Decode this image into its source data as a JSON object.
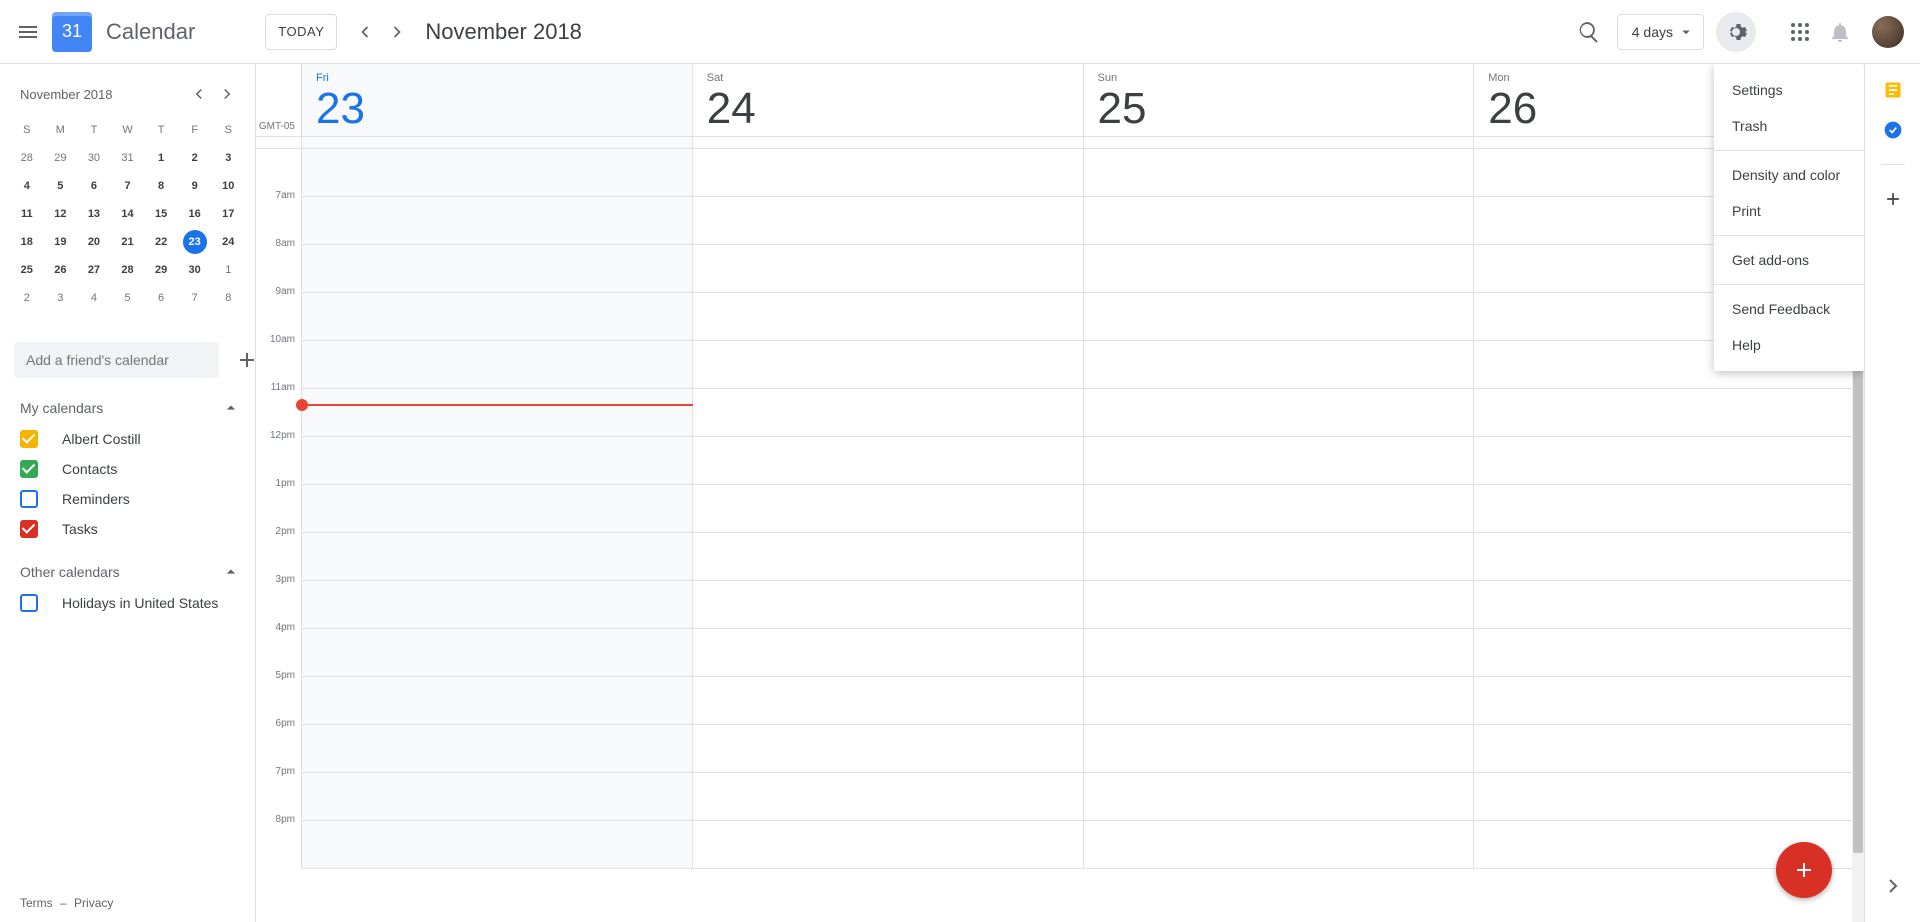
{
  "header": {
    "logo_day": "31",
    "logo_text": "Calendar",
    "today_label": "TODAY",
    "date_label": "November 2018",
    "view_label": "4 days"
  },
  "settings_menu": {
    "groups": [
      [
        "Settings",
        "Trash"
      ],
      [
        "Density and color",
        "Print"
      ],
      [
        "Get add-ons"
      ],
      [
        "Send Feedback",
        "Help"
      ]
    ]
  },
  "mini_cal": {
    "title": "November 2018",
    "dow": [
      "S",
      "M",
      "T",
      "W",
      "T",
      "F",
      "S"
    ],
    "weeks": [
      [
        {
          "n": "28"
        },
        {
          "n": "29"
        },
        {
          "n": "30"
        },
        {
          "n": "31"
        },
        {
          "n": "1",
          "b": true
        },
        {
          "n": "2",
          "b": true
        },
        {
          "n": "3",
          "b": true
        }
      ],
      [
        {
          "n": "4",
          "b": true
        },
        {
          "n": "5",
          "b": true
        },
        {
          "n": "6",
          "b": true
        },
        {
          "n": "7",
          "b": true
        },
        {
          "n": "8",
          "b": true
        },
        {
          "n": "9",
          "b": true
        },
        {
          "n": "10",
          "b": true
        }
      ],
      [
        {
          "n": "11",
          "b": true
        },
        {
          "n": "12",
          "b": true
        },
        {
          "n": "13",
          "b": true
        },
        {
          "n": "14",
          "b": true
        },
        {
          "n": "15",
          "b": true
        },
        {
          "n": "16",
          "b": true
        },
        {
          "n": "17",
          "b": true
        }
      ],
      [
        {
          "n": "18",
          "b": true
        },
        {
          "n": "19",
          "b": true
        },
        {
          "n": "20",
          "b": true
        },
        {
          "n": "21",
          "b": true
        },
        {
          "n": "22",
          "b": true
        },
        {
          "n": "23",
          "b": true,
          "today": true
        },
        {
          "n": "24",
          "b": true
        }
      ],
      [
        {
          "n": "25",
          "b": true
        },
        {
          "n": "26",
          "b": true
        },
        {
          "n": "27",
          "b": true
        },
        {
          "n": "28",
          "b": true
        },
        {
          "n": "29",
          "b": true
        },
        {
          "n": "30",
          "b": true
        },
        {
          "n": "1"
        }
      ],
      [
        {
          "n": "2"
        },
        {
          "n": "3"
        },
        {
          "n": "4"
        },
        {
          "n": "5"
        },
        {
          "n": "6"
        },
        {
          "n": "7"
        },
        {
          "n": "8"
        }
      ]
    ]
  },
  "add_friend_placeholder": "Add a friend's calendar",
  "sections": {
    "my_calendars": {
      "title": "My calendars",
      "items": [
        {
          "label": "Albert Costill",
          "color": "#f5b400",
          "checked": true
        },
        {
          "label": "Contacts",
          "color": "#34a853",
          "checked": true
        },
        {
          "label": "Reminders",
          "color": "#1a73e8",
          "checked": false
        },
        {
          "label": "Tasks",
          "color": "#d93025",
          "checked": true
        }
      ]
    },
    "other_calendars": {
      "title": "Other calendars",
      "items": [
        {
          "label": "Holidays in United States",
          "color": "#1a73e8",
          "checked": false
        }
      ]
    }
  },
  "footer": {
    "terms": "Terms",
    "sep": "–",
    "privacy": "Privacy"
  },
  "grid": {
    "timezone": "GMT-05",
    "days": [
      {
        "dow": "Fri",
        "num": "23",
        "today": true
      },
      {
        "dow": "Sat",
        "num": "24"
      },
      {
        "dow": "Sun",
        "num": "25"
      },
      {
        "dow": "Mon",
        "num": "26"
      }
    ],
    "hours": [
      "7am",
      "8am",
      "9am",
      "10am",
      "11am",
      "12pm",
      "1pm",
      "2pm",
      "3pm",
      "4pm",
      "5pm",
      "6pm",
      "7pm",
      "8pm"
    ],
    "now_offset_rows": 4.3
  }
}
